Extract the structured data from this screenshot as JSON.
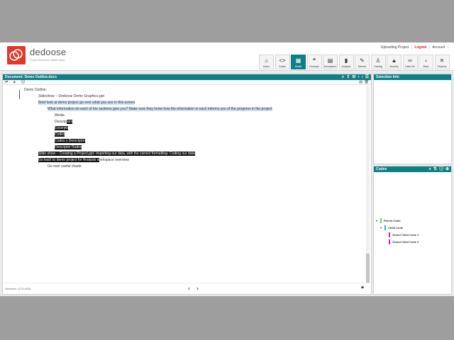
{
  "header": {
    "brand": "dedoose",
    "tagline": "Great Research Made Easy",
    "links": {
      "project": "Uploading Project",
      "logout": "Logout",
      "account": "Account"
    }
  },
  "toolbar": [
    {
      "label": "Home",
      "icon": "home-icon",
      "active": false
    },
    {
      "label": "Codes",
      "icon": "code-brackets-icon",
      "active": false
    },
    {
      "label": "Media",
      "icon": "media-icon",
      "active": true
    },
    {
      "label": "Excerpts",
      "icon": "quote-icon",
      "active": false
    },
    {
      "label": "Descriptors",
      "icon": "clipboard-icon",
      "active": false
    },
    {
      "label": "Analysis",
      "icon": "bar-chart-icon",
      "active": false
    },
    {
      "label": "Memos",
      "icon": "memo-icon",
      "active": false
    },
    {
      "label": "Training",
      "icon": "person-icon",
      "active": false
    },
    {
      "label": "Security",
      "icon": "lock-icon",
      "active": false
    },
    {
      "label": "Data Set",
      "icon": "binoculars-icon",
      "active": false
    },
    {
      "label": "Back",
      "icon": "chevron-left-icon",
      "active": false
    },
    {
      "label": "Projects",
      "icon": "tools-icon",
      "active": false
    }
  ],
  "document": {
    "title": "Document: Demo Outline.docx",
    "lines": [
      {
        "segments": [
          {
            "text": "Demo Outline:",
            "hl": ""
          }
        ]
      },
      {
        "segments": [
          {
            "text": "Slideshow – Dedoose Demo Graphics.ppt",
            "hl": ""
          }
        ]
      },
      {
        "segments": [
          {
            "text": "Brief look at demo project go over what you see in this screen",
            "hl": "blue"
          }
        ]
      },
      {
        "segments": [
          {
            "text": "What information do each of the sections give you? Make sure they know how the information in each informs you of the progress in the project",
            "hl": "blue"
          }
        ]
      },
      {
        "segments": [
          {
            "text": "Media",
            "hl": ""
          }
        ]
      },
      {
        "segments": [
          {
            "text": "Descrip",
            "hl": ""
          },
          {
            "text": "tors",
            "hl": "black"
          }
        ]
      },
      {
        "segments": [
          {
            "text": "Excerpts",
            "hl": "black"
          }
        ]
      },
      {
        "segments": [
          {
            "text": "Codes",
            "hl": "black"
          }
        ]
      },
      {
        "segments": [
          {
            "text": "Codes x Descriptor",
            "hl": "black"
          }
        ]
      },
      {
        "segments": [
          {
            "text": "Descriptor Ratios",
            "hl": "black"
          }
        ]
      },
      {
        "segments": [
          {
            "text": "Slide show – Creating a Project.ppt- Importing our data, with the correct formatting- Coding our data",
            "hl": "black"
          }
        ]
      },
      {
        "segments": [
          {
            "text": "Go back to demo project for Analysis w",
            "hl": "black"
          },
          {
            "text": "orkspace overview",
            "hl": ""
          }
        ]
      },
      {
        "segments": [
          {
            "text": "Go over useful charts",
            "hl": ""
          }
        ]
      }
    ],
    "selection": "Selection: (270-455)"
  },
  "selection_info": {
    "title": "Selection Info"
  },
  "codes": {
    "title": "Codes",
    "items": [
      {
        "label": "Parent Code",
        "color": "#7ec850"
      },
      {
        "label": "Child Code",
        "color": "#27b3c7"
      },
      {
        "label": "Grand Child Code 1",
        "color": "#b02fb5"
      },
      {
        "label": "Grand Child Code 2",
        "color": "#b02fb5"
      }
    ]
  }
}
